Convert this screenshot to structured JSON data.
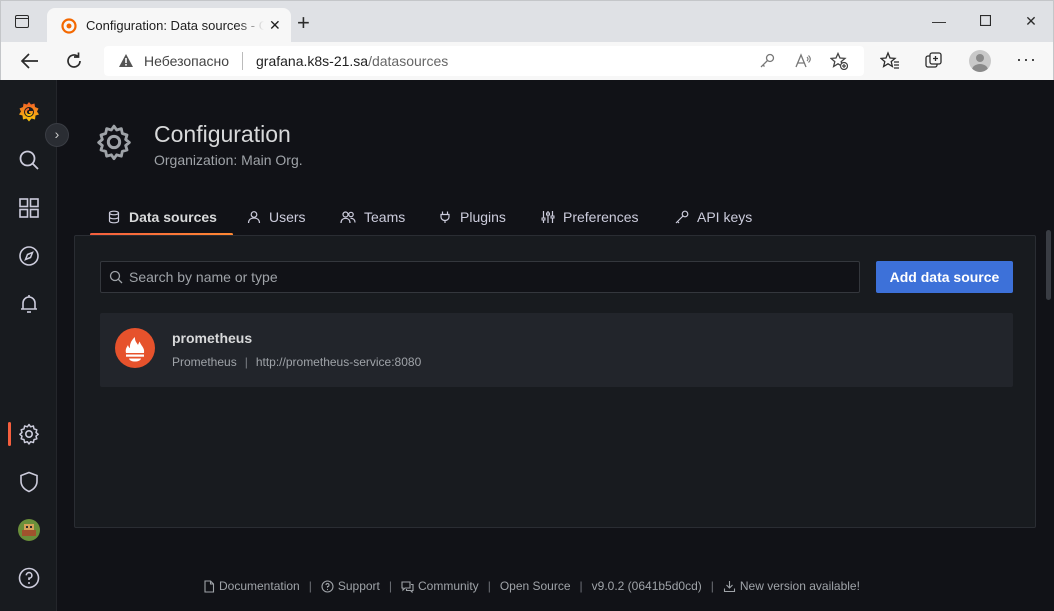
{
  "browser": {
    "tab_title": "Configuration: Data sources - Grafana",
    "insecure_label": "Небезопасно",
    "url_host": "grafana.k8s-21.sa",
    "url_path": "/datasources"
  },
  "page": {
    "title": "Configuration",
    "subtitle": "Organization: Main Org."
  },
  "tabs": [
    {
      "label": "Data sources",
      "icon": "database-icon",
      "active": true
    },
    {
      "label": "Users",
      "icon": "user-icon"
    },
    {
      "label": "Teams",
      "icon": "users-icon"
    },
    {
      "label": "Plugins",
      "icon": "plug-icon"
    },
    {
      "label": "Preferences",
      "icon": "sliders-icon"
    },
    {
      "label": "API keys",
      "icon": "key-icon"
    }
  ],
  "search": {
    "placeholder": "Search by name or type"
  },
  "add_button": {
    "label": "Add data source"
  },
  "datasource": {
    "name": "prometheus",
    "type": "Prometheus",
    "separator": "|",
    "url": "http://prometheus-service:8080"
  },
  "footer": {
    "documentation": "Documentation",
    "support": "Support",
    "community": "Community",
    "open_source": "Open Source",
    "version": "v9.0.2 (0641b5d0cd)",
    "new_version": "New version available!",
    "separator": "|"
  },
  "colors": {
    "accent": "#f55f3e",
    "primary_button": "#3d71d9",
    "background": "#111217",
    "panel": "#181b1f"
  }
}
